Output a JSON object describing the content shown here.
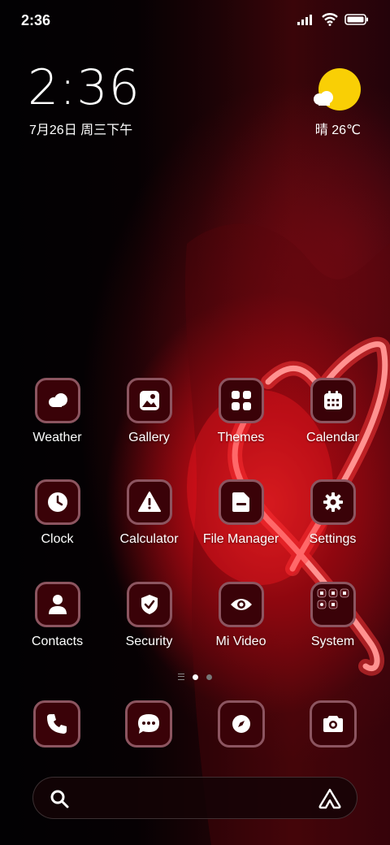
{
  "status_bar": {
    "time": "2:36",
    "icons": [
      "signal-icon",
      "wifi-icon",
      "battery-icon"
    ]
  },
  "clock_widget": {
    "time": "2:36",
    "date": "7月26日 周三下午"
  },
  "weather_widget": {
    "icon": "sun-cloud-icon",
    "text": "晴 26℃",
    "sun_color": "#f9cf05"
  },
  "apps": [
    {
      "label": "Weather",
      "icon": "weather-icon"
    },
    {
      "label": "Gallery",
      "icon": "gallery-icon"
    },
    {
      "label": "Themes",
      "icon": "themes-icon"
    },
    {
      "label": "Calendar",
      "icon": "calendar-icon"
    },
    {
      "label": "Clock",
      "icon": "clock-icon"
    },
    {
      "label": "Calculator",
      "icon": "calculator-icon"
    },
    {
      "label": "File Manager",
      "icon": "file-manager-icon"
    },
    {
      "label": "Settings",
      "icon": "settings-icon"
    },
    {
      "label": "Contacts",
      "icon": "contacts-icon"
    },
    {
      "label": "Security",
      "icon": "security-icon"
    },
    {
      "label": "Mi Video",
      "icon": "mi-video-icon"
    },
    {
      "label": "System",
      "icon": "system-folder-icon"
    }
  ],
  "pager": {
    "current_page": 1,
    "page_count": 2
  },
  "dock": [
    {
      "icon": "phone-icon"
    },
    {
      "icon": "messages-icon"
    },
    {
      "icon": "browser-icon"
    },
    {
      "icon": "camera-icon"
    }
  ],
  "search_bar": {
    "icon": "search-icon",
    "right_icon": "assistant-icon"
  },
  "colors": {
    "tile_background": "#3a0208",
    "tile_border": "#8c5560",
    "accent_red": "#e0141e"
  }
}
